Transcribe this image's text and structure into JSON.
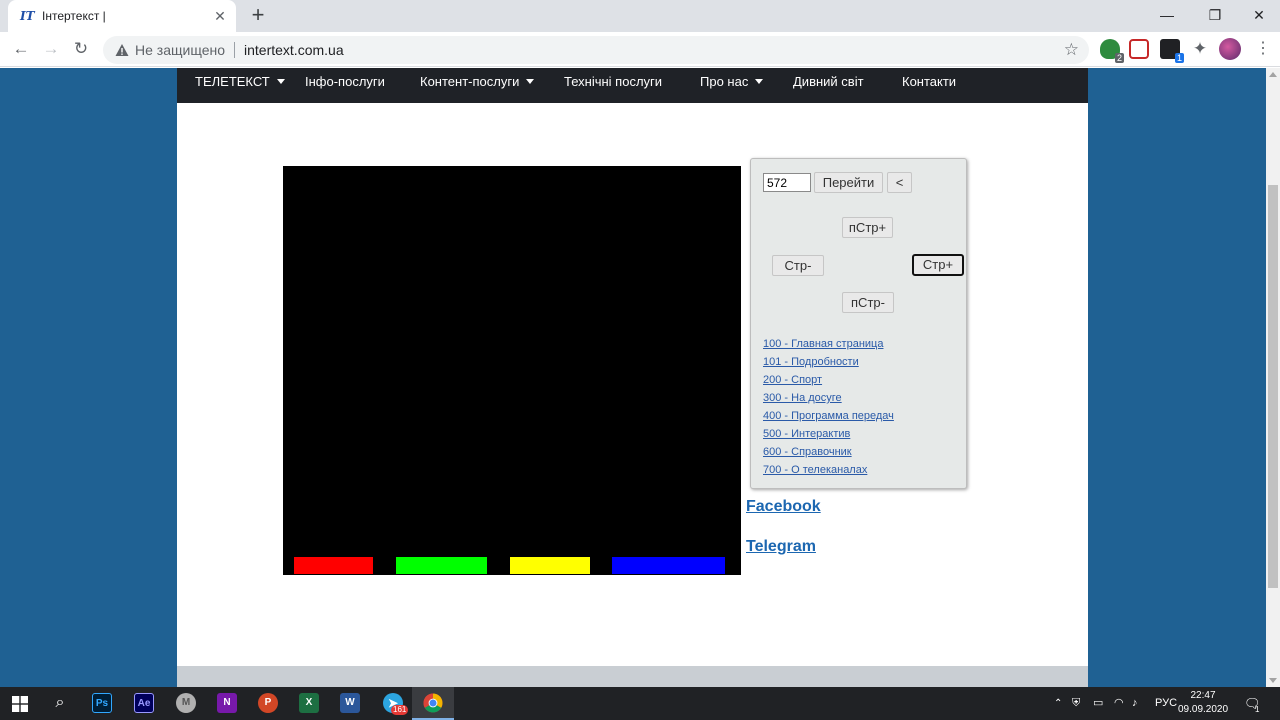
{
  "browser": {
    "tab_title": "Інтертекст |",
    "tab_favicon": "IT",
    "security_label": "Не защищено",
    "url": "intertext.com.ua",
    "extension_badges": [
      "2",
      "1"
    ]
  },
  "site": {
    "nav": [
      {
        "label": "ТЕЛЕТЕКСТ",
        "dropdown": true
      },
      {
        "label": "Інфо-послуги",
        "dropdown": false
      },
      {
        "label": "Контент-послуги",
        "dropdown": true
      },
      {
        "label": "Технічні послуги",
        "dropdown": false
      },
      {
        "label": "Про нас",
        "dropdown": true
      },
      {
        "label": "Дивний світ",
        "dropdown": false
      },
      {
        "label": "Контакти",
        "dropdown": false
      }
    ]
  },
  "teletext": {
    "color_keys": [
      "#ff0000",
      "#00ff00",
      "#ffff00",
      "#0000ff"
    ]
  },
  "panel": {
    "page_input": "572",
    "go_label": "Перейти",
    "back_label": "<",
    "next_sub_label": "пСтр+",
    "prev_page_label": "Стр-",
    "next_page_label": "Стр+",
    "prev_sub_label": "пСтр-",
    "links": [
      "100 - Главная страница",
      "101 - Подробности",
      "200 - Спорт",
      "300 - На досуге",
      "400 - Программа передач",
      "500 - Интерактив",
      "600 - Справочник",
      "700 - О телеканалах"
    ]
  },
  "social": {
    "facebook": "Facebook",
    "telegram": "Telegram"
  },
  "taskbar": {
    "telegram_badge": "161",
    "language": "РУС",
    "time": "22:47",
    "date": "09.09.2020",
    "notification_count": "1"
  }
}
